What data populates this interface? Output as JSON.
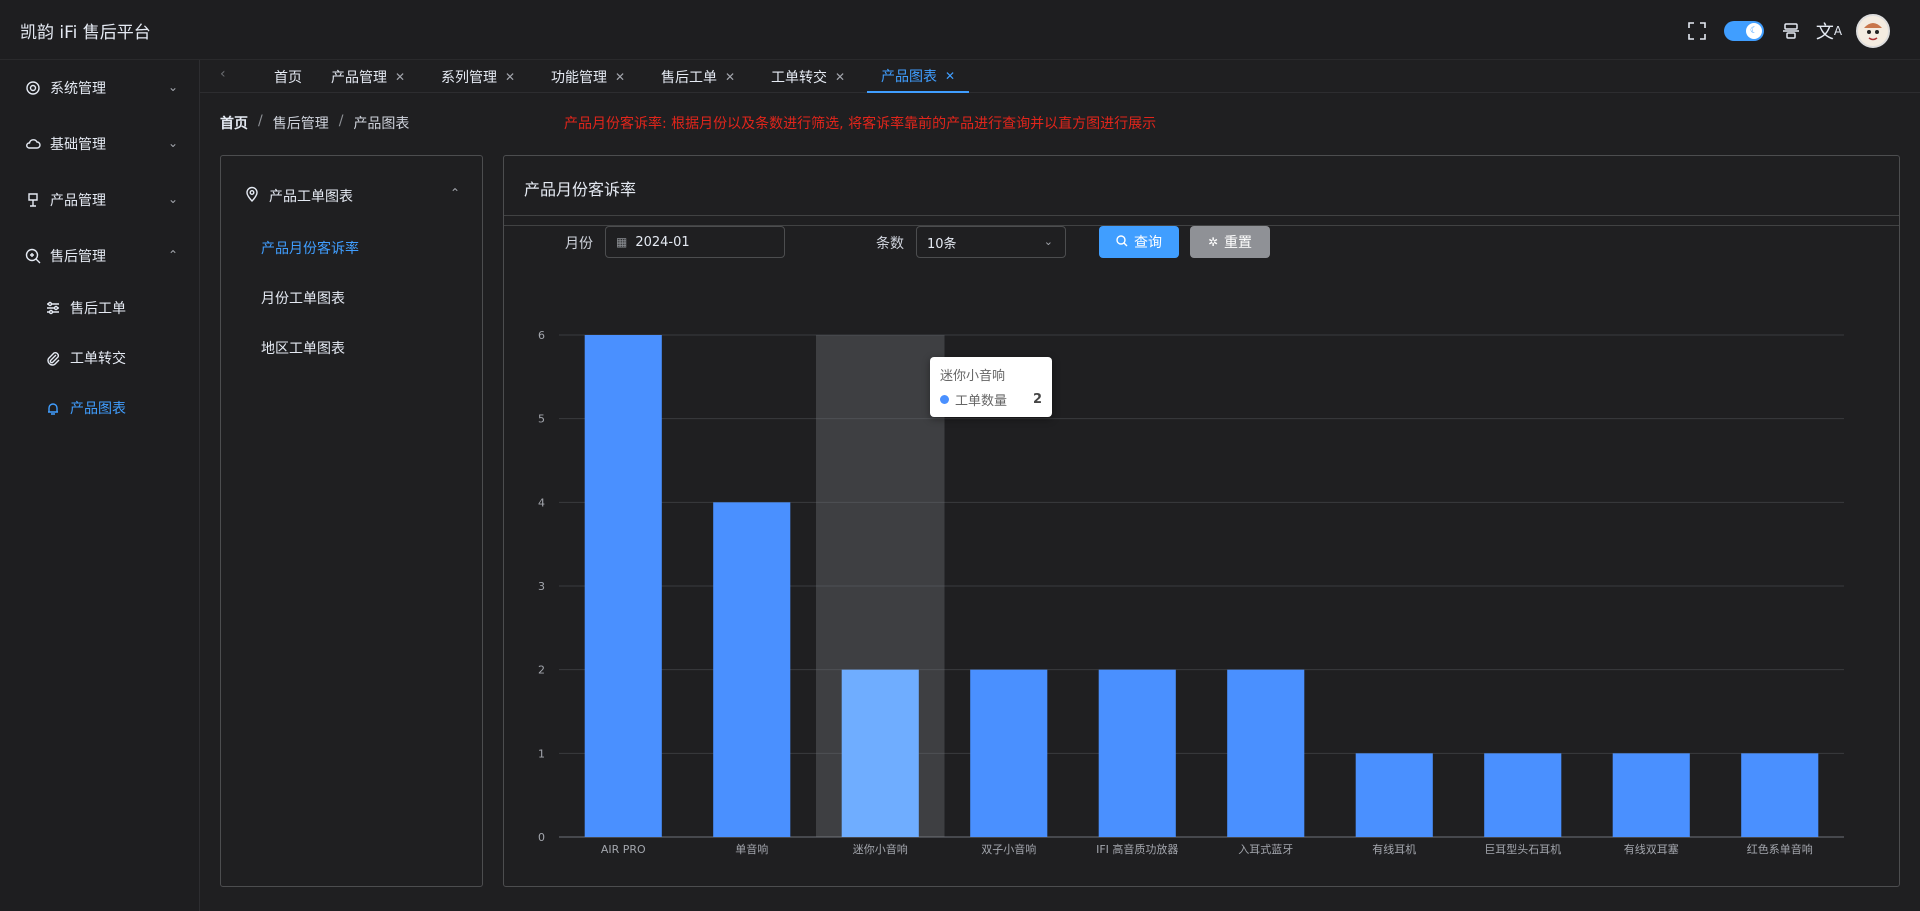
{
  "header": {
    "title": "凯韵 iFi 售后平台"
  },
  "sidebar": {
    "items": [
      {
        "label": "系统管理"
      },
      {
        "label": "基础管理"
      },
      {
        "label": "产品管理"
      },
      {
        "label": "售后管理"
      }
    ],
    "subitems": [
      {
        "label": "售后工单"
      },
      {
        "label": "工单转交"
      },
      {
        "label": "产品图表"
      }
    ]
  },
  "tabs": [
    {
      "label": "首页"
    },
    {
      "label": "产品管理"
    },
    {
      "label": "系列管理"
    },
    {
      "label": "功能管理"
    },
    {
      "label": "售后工单"
    },
    {
      "label": "工单转交"
    },
    {
      "label": "产品图表"
    }
  ],
  "breadcrumb": [
    "首页",
    "售后管理",
    "产品图表"
  ],
  "notice": "产品月份客诉率: 根据月份以及条数进行筛选, 将客诉率靠前的产品进行查询并以直方图进行展示",
  "left_panel": {
    "group_label": "产品工单图表",
    "items": [
      {
        "label": "产品月份客诉率"
      },
      {
        "label": "月份工单图表"
      },
      {
        "label": "地区工单图表"
      }
    ]
  },
  "card": {
    "title": "产品月份客诉率",
    "month_label": "月份",
    "month_value": "2024-01",
    "count_label": "条数",
    "count_value": "10条",
    "query_label": "查询",
    "reset_label": "重置"
  },
  "tooltip": {
    "title": "迷你小音响",
    "series": "工单数量",
    "value": "2"
  },
  "colors": {
    "bar": "#4a90ff",
    "bar_hover": "#6fadff",
    "accent": "#409eff",
    "notice": "#e1251b"
  },
  "chart_data": {
    "type": "bar",
    "categories": [
      "AIR PRO",
      "单音响",
      "迷你小音响",
      "双子小音响",
      "IFI 高音质功放器",
      "入耳式蓝牙",
      "有线耳机",
      "巨耳型头石耳机",
      "有线双耳塞",
      "红色系单音响"
    ],
    "series": [
      {
        "name": "工单数量",
        "values": [
          6,
          4,
          2,
          2,
          2,
          2,
          1,
          1,
          1,
          1
        ]
      }
    ],
    "ylim": [
      0,
      6
    ],
    "yticks": [
      0,
      1,
      2,
      3,
      4,
      5,
      6
    ],
    "grid": true,
    "highlighted_category": "迷你小音响"
  }
}
